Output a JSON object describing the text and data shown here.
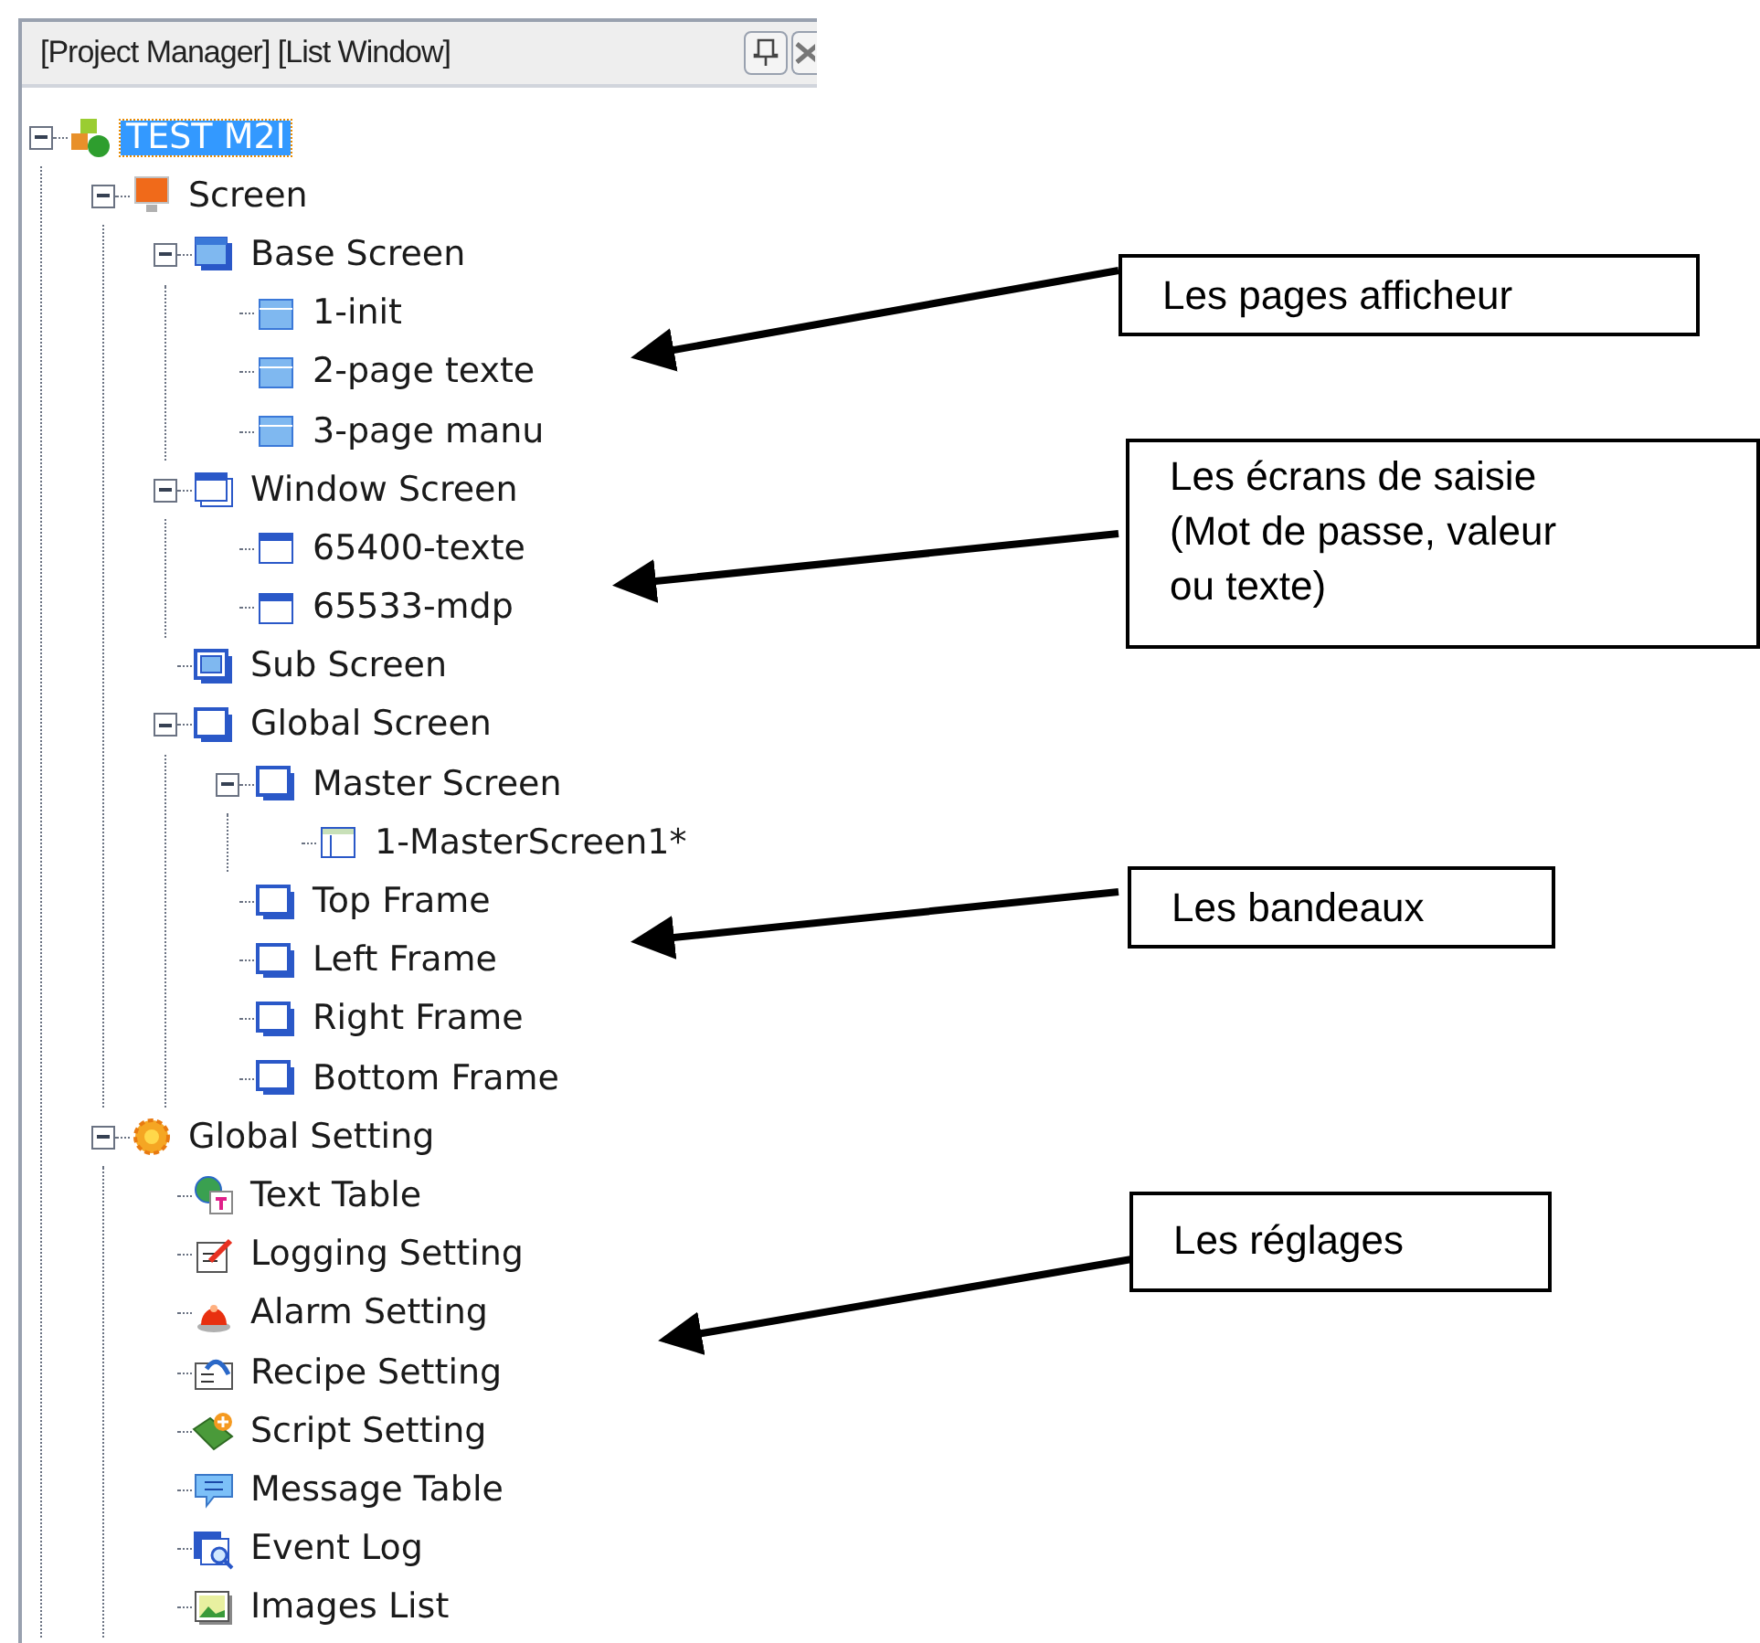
{
  "panel": {
    "title": "[Project Manager] [List Window]"
  },
  "tree": [
    {
      "label": "TEST M2I",
      "kind": "project",
      "selected": true,
      "expanded": true,
      "children": [
        {
          "label": "Screen",
          "kind": "monitor",
          "selected": false,
          "expanded": true,
          "children": [
            {
              "label": "Base Screen",
              "kind": "base-group",
              "selected": false,
              "expanded": true,
              "children": [
                {
                  "label": "1-init",
                  "kind": "base-page",
                  "selected": false
                },
                {
                  "label": "2-page texte",
                  "kind": "base-page",
                  "selected": false
                },
                {
                  "label": "3-page manu",
                  "kind": "base-page",
                  "selected": false
                }
              ]
            },
            {
              "label": "Window Screen",
              "kind": "window-group",
              "selected": false,
              "expanded": true,
              "children": [
                {
                  "label": "65400-texte",
                  "kind": "window-page",
                  "selected": false
                },
                {
                  "label": "65533-mdp",
                  "kind": "window-page",
                  "selected": false
                }
              ]
            },
            {
              "label": "Sub Screen",
              "kind": "sub-group",
              "selected": false
            },
            {
              "label": "Global Screen",
              "kind": "frame-group",
              "selected": false,
              "expanded": true,
              "children": [
                {
                  "label": "Master Screen",
                  "kind": "frame-group",
                  "selected": false,
                  "expanded": true,
                  "children": [
                    {
                      "label": "1-MasterScreen1*",
                      "kind": "master-page",
                      "selected": false
                    }
                  ]
                },
                {
                  "label": "Top Frame",
                  "kind": "frame-group",
                  "selected": false
                },
                {
                  "label": "Left Frame",
                  "kind": "frame-group",
                  "selected": false
                },
                {
                  "label": "Right Frame",
                  "kind": "frame-group",
                  "selected": false
                },
                {
                  "label": "Bottom Frame",
                  "kind": "frame-group",
                  "selected": false
                }
              ]
            }
          ]
        },
        {
          "label": "Global Setting",
          "kind": "gear",
          "selected": false,
          "expanded": true,
          "children": [
            {
              "label": "Text Table",
              "kind": "text-table",
              "selected": false
            },
            {
              "label": "Logging Setting",
              "kind": "logging",
              "selected": false
            },
            {
              "label": "Alarm Setting",
              "kind": "alarm",
              "selected": false
            },
            {
              "label": "Recipe Setting",
              "kind": "recipe",
              "selected": false
            },
            {
              "label": "Script Setting",
              "kind": "script",
              "selected": false
            },
            {
              "label": "Message Table",
              "kind": "message",
              "selected": false
            },
            {
              "label": "Event Log",
              "kind": "event",
              "selected": false
            },
            {
              "label": "Images List",
              "kind": "images",
              "selected": false
            }
          ]
        }
      ]
    }
  ],
  "callouts": [
    {
      "text": "Les pages afficheur"
    },
    {
      "text": "Les écrans de saisie (Mot de passe, valeur ou texte)"
    },
    {
      "text": "Les bandeaux"
    },
    {
      "text": "Les réglages"
    }
  ]
}
